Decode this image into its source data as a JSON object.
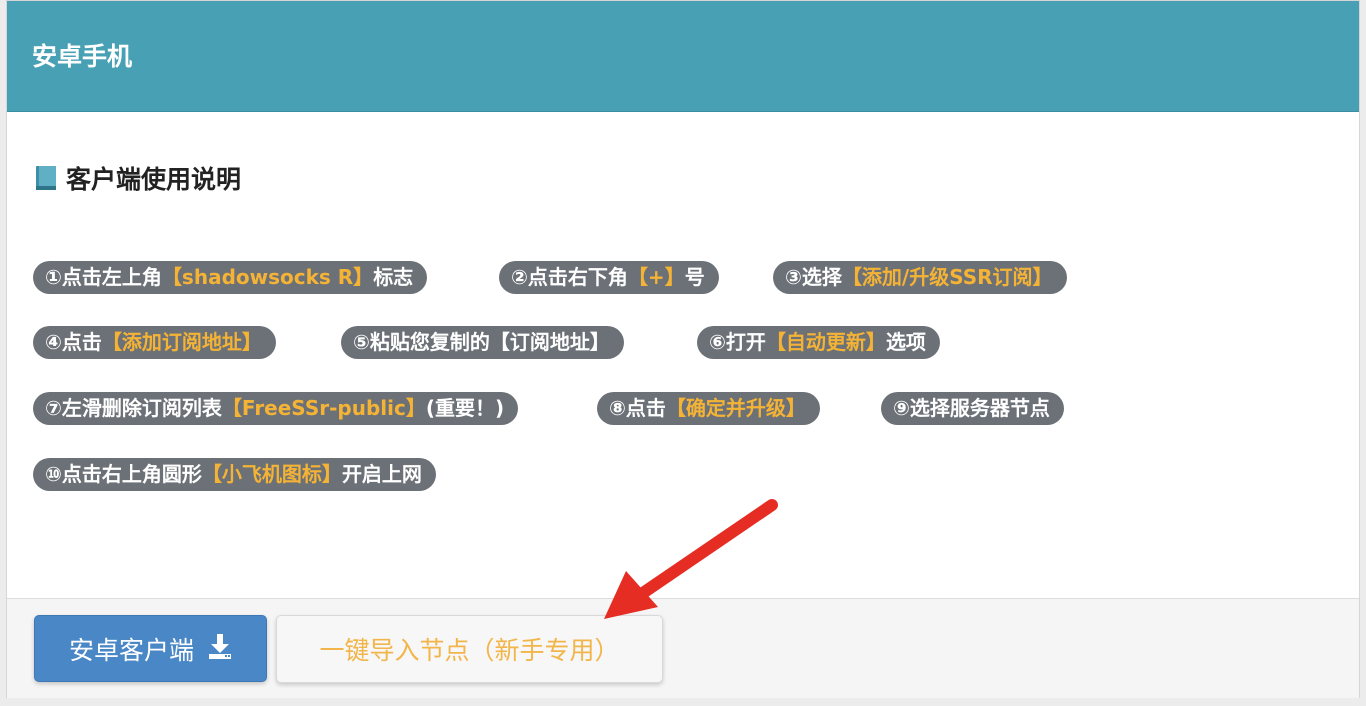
{
  "panel": {
    "title": "安卓手机",
    "section_title": "客户端使用说明"
  },
  "steps": [
    {
      "prefix": "①点击左上角",
      "highlight": "【shadowsocks R】",
      "suffix": "标志"
    },
    {
      "prefix": "②点击右下角",
      "highlight": "【+】",
      "suffix": "号"
    },
    {
      "prefix": "③选择",
      "highlight": "【添加/升级SSR订阅】",
      "suffix": ""
    },
    {
      "prefix": "④点击",
      "highlight": "【添加订阅地址】",
      "suffix": ""
    },
    {
      "prefix": "⑤粘贴您复制的【订阅地址】",
      "highlight": "",
      "suffix": ""
    },
    {
      "prefix": "⑥打开",
      "highlight": "【自动更新】",
      "suffix": "选项"
    },
    {
      "prefix": "⑦左滑删除订阅列表",
      "highlight": "【FreeSSr-public】",
      "suffix": "(重要！)"
    },
    {
      "prefix": "⑧点击",
      "highlight": "【确定并升级】",
      "suffix": ""
    },
    {
      "prefix": "⑨选择服务器节点",
      "highlight": "",
      "suffix": ""
    },
    {
      "prefix": "⑩点击右上角圆形",
      "highlight": "【小飞机图标】",
      "suffix": "开启上网"
    }
  ],
  "footer": {
    "download_label": "安卓客户端",
    "import_label": "一键导入节点（新手专用）"
  },
  "colors": {
    "header_bg": "#48a0b4",
    "tag_bg": "#6c7178",
    "highlight": "#f5b335",
    "primary": "#4a87c6",
    "arrow": "#e62d23"
  },
  "icons": {
    "section": "book-icon",
    "download": "download-icon"
  }
}
